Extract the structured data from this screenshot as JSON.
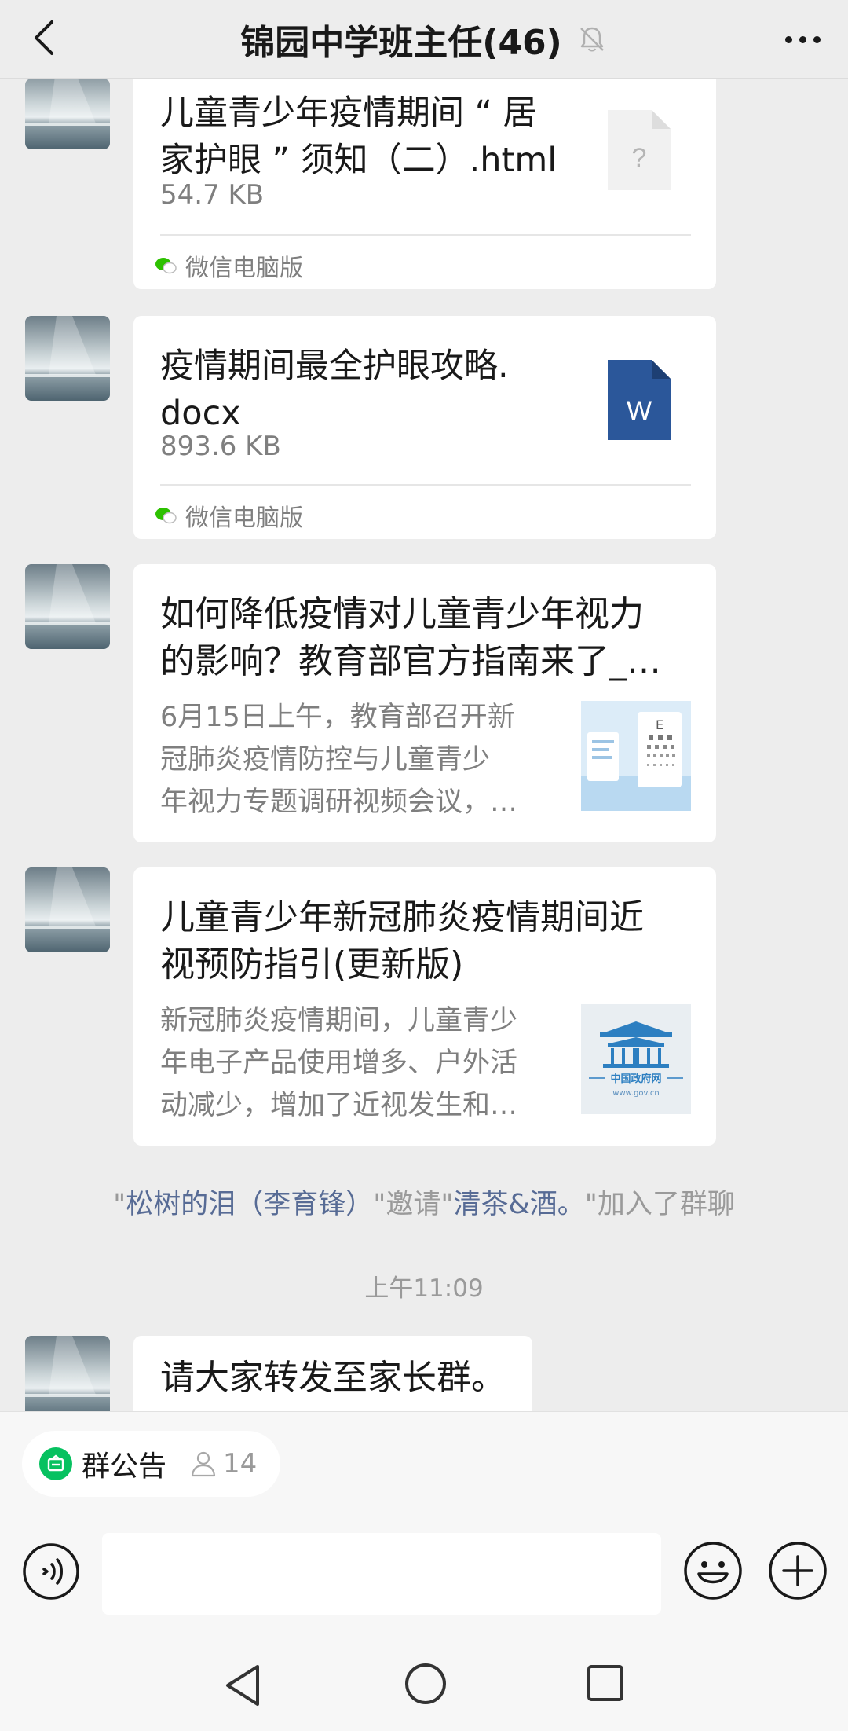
{
  "header": {
    "title": "锦园中学班主任(46)",
    "icons": {
      "back": "back-arrow-icon",
      "mute": "bell-off-icon",
      "more": "more-dots-icon"
    }
  },
  "messages": [
    {
      "type": "file",
      "name_lines": [
        "儿童青少年疫情期间 “ 居",
        "家护眼 ” 须知（二）.html"
      ],
      "size": "54.7 KB",
      "source": "微信电脑版",
      "file_icon": "unknown-file-icon",
      "icon_glyph": "?"
    },
    {
      "type": "file",
      "name_lines": [
        "疫情期间最全护眼攻略.",
        "docx"
      ],
      "size": "893.6 KB",
      "source": "微信电脑版",
      "file_icon": "word-file-icon",
      "icon_glyph": "W"
    },
    {
      "type": "link",
      "title_lines": [
        "如何降低疫情对儿童青少年视力",
        "的影响？教育部官方指南来了_…"
      ],
      "desc_lines": [
        "6月15日上午，教育部召开新",
        "冠肺炎疫情防控与儿童青少",
        "年视力专题调研视频会议，…"
      ],
      "thumb": "eye-chart-thumbnail"
    },
    {
      "type": "link",
      "title_lines": [
        "儿童青少年新冠肺炎疫情期间近",
        "视预防指引(更新版)"
      ],
      "desc_lines": [
        "新冠肺炎疫情期间，儿童青少",
        "年电子产品使用增多、户外活",
        "动减少，增加了近视发生和…"
      ],
      "thumb": "gov-logo-thumbnail",
      "thumb_text": "中国政府网",
      "thumb_url": "www.gov.cn"
    }
  ],
  "system_message": {
    "q1": "\"",
    "inviter": "松树的泪（李育锋）",
    "mid": "\"邀请\"",
    "invitee": "清茶&酒。",
    "tail": "\"加入了群聊"
  },
  "time_label": "上午11:09",
  "last_message": "请大家转发至家长群。",
  "bottom": {
    "notice_label": "群公告",
    "notice_count": "14",
    "icons": {
      "voice": "voice-icon",
      "emoji": "emoji-icon",
      "plus": "plus-icon"
    }
  },
  "colors": {
    "background": "#ededed",
    "link_name": "#576b95",
    "word_blue": "#2b579a",
    "notice_green": "#07c160"
  }
}
